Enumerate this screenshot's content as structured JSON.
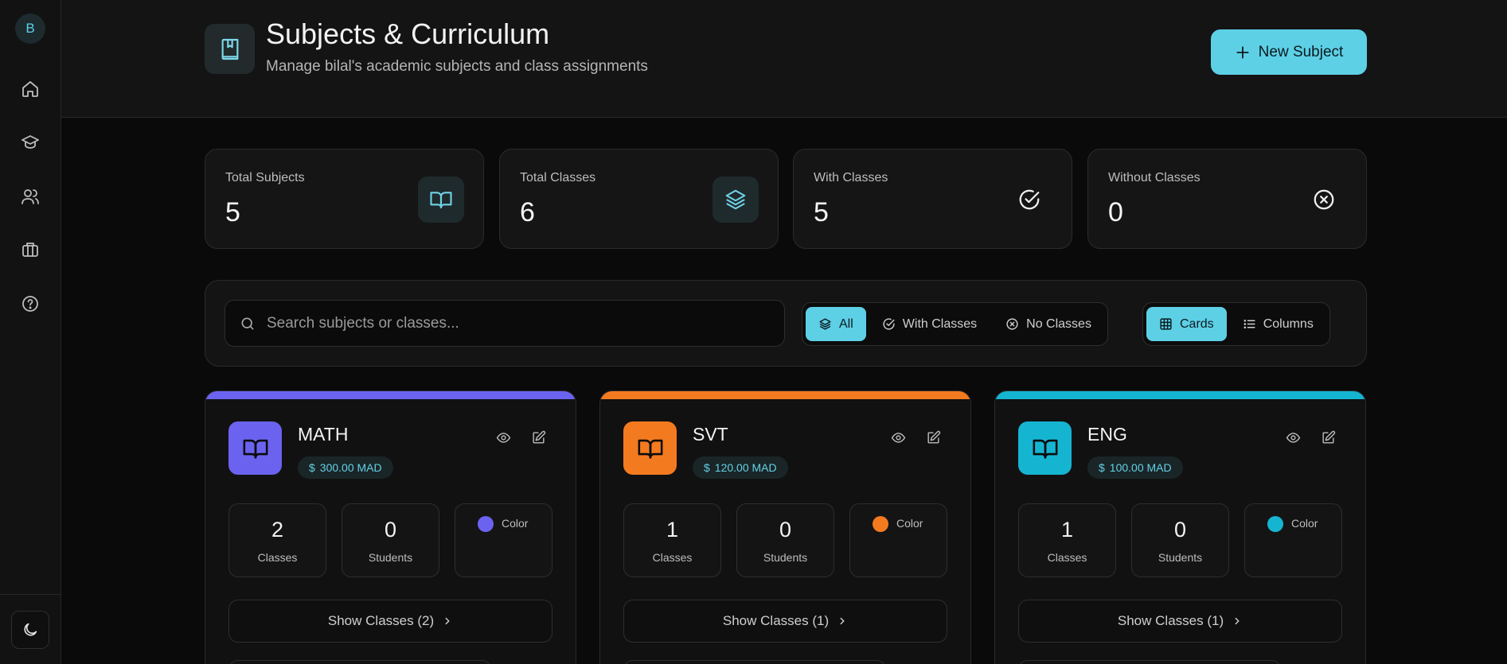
{
  "sidebar": {
    "avatar_initial": "B",
    "nav_items": [
      {
        "icon": "home-icon"
      },
      {
        "icon": "graduation-cap-icon"
      },
      {
        "icon": "users-icon"
      },
      {
        "icon": "briefcase-icon"
      },
      {
        "icon": "help-circle-icon"
      }
    ],
    "theme_toggle_icon": "moon-icon"
  },
  "header": {
    "icon": "book-bookmark-icon",
    "title": "Subjects & Curriculum",
    "subtitle": "Manage bilal's academic subjects and class assignments",
    "new_button_label": "New Subject"
  },
  "stats": [
    {
      "label": "Total Subjects",
      "value": "5",
      "icon": "book-open-icon"
    },
    {
      "label": "Total Classes",
      "value": "6",
      "icon": "layers-icon"
    },
    {
      "label": "With Classes",
      "value": "5",
      "icon": "check-circle-icon"
    },
    {
      "label": "Without Classes",
      "value": "0",
      "icon": "x-circle-icon"
    }
  ],
  "filters": {
    "search_placeholder": "Search subjects or classes...",
    "scope_options": [
      {
        "label": "All",
        "active": true
      },
      {
        "label": "With Classes",
        "active": false
      },
      {
        "label": "No Classes",
        "active": false
      }
    ],
    "view_options": [
      {
        "label": "Cards",
        "active": true
      },
      {
        "label": "Columns",
        "active": false
      }
    ]
  },
  "subjects": [
    {
      "name": "MATH",
      "price": "300.00 MAD",
      "classes": "2",
      "classes_label": "Classes",
      "students": "0",
      "students_label": "Students",
      "color_label": "Color",
      "color": "#6b63f0",
      "show_label": "Show Classes (2)"
    },
    {
      "name": "SVT",
      "price": "120.00 MAD",
      "classes": "1",
      "classes_label": "Classes",
      "students": "0",
      "students_label": "Students",
      "color_label": "Color",
      "color": "#f47a1f",
      "show_label": "Show Classes (1)"
    },
    {
      "name": "ENG",
      "price": "100.00 MAD",
      "classes": "1",
      "classes_label": "Classes",
      "students": "0",
      "students_label": "Students",
      "color_label": "Color",
      "color": "#15b5d2",
      "show_label": "Show Classes (1)"
    }
  ],
  "colors": {
    "accent": "#5dd0e6",
    "background": "#0a0a0a",
    "panel": "#141414"
  }
}
